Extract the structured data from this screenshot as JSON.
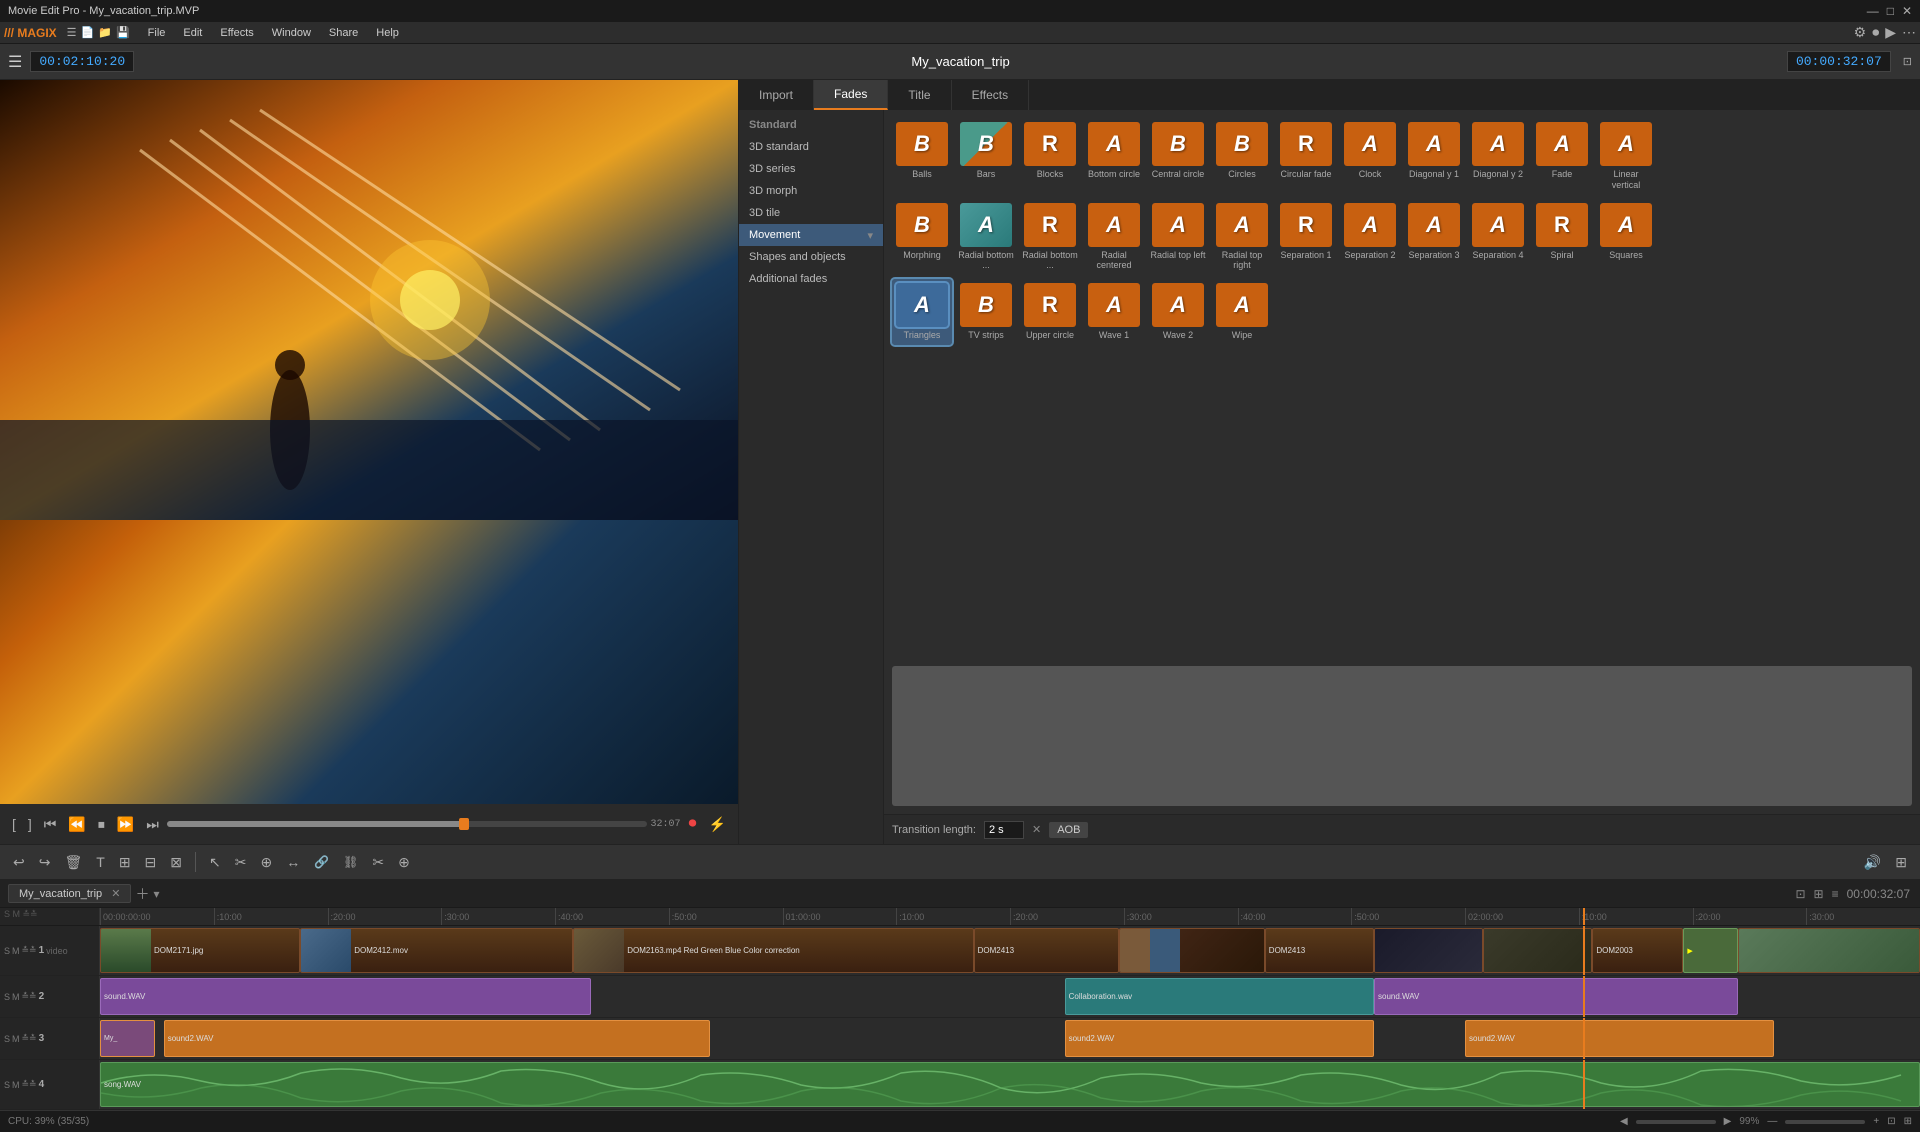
{
  "titlebar": {
    "title": "Movie Edit Pro - My_vacation_trip.MVP",
    "minimize": "—",
    "maximize": "□",
    "close": "✕"
  },
  "menubar": {
    "logo": "/// MAGIX",
    "items": [
      "File",
      "Edit",
      "Effects",
      "Window",
      "Share",
      "Help"
    ]
  },
  "transport": {
    "timecode_left": "00:02:10:20",
    "project_name": "My_vacation_trip",
    "timecode_right": "00:00:32:07"
  },
  "panel_tabs": [
    "Import",
    "Fades",
    "Title",
    "Effects"
  ],
  "active_panel_tab": "Fades",
  "categories": {
    "standard_label": "Standard",
    "items": [
      {
        "id": "3d_standard",
        "label": "3D standard"
      },
      {
        "id": "3d_series",
        "label": "3D series"
      },
      {
        "id": "3d_morph",
        "label": "3D morph"
      },
      {
        "id": "3d_tile",
        "label": "3D tile"
      },
      {
        "id": "movement",
        "label": "Movement",
        "active": true
      },
      {
        "id": "shapes_objects",
        "label": "Shapes and objects"
      },
      {
        "id": "additional_fades",
        "label": "Additional fades"
      }
    ]
  },
  "effects": [
    {
      "id": "balls",
      "label": "Balls",
      "letter": "B",
      "type": "orange"
    },
    {
      "id": "bars",
      "label": "Bars",
      "letter": "B",
      "type": "orange-teal"
    },
    {
      "id": "blocks",
      "label": "Blocks",
      "letter": "R",
      "type": "orange-r"
    },
    {
      "id": "bottom_circle",
      "label": "Bottom circle",
      "letter": "A",
      "type": "orange-a"
    },
    {
      "id": "central_circle",
      "label": "Central circle",
      "letter": "B",
      "type": "orange-b"
    },
    {
      "id": "circles",
      "label": "Circles",
      "letter": "B",
      "type": "orange-b2"
    },
    {
      "id": "circular_fade",
      "label": "Circular fade",
      "letter": "R",
      "type": "orange-r2"
    },
    {
      "id": "clock",
      "label": "Clock",
      "letter": "A",
      "type": "orange-a2"
    },
    {
      "id": "diagonal_y1",
      "label": "Diagonal y 1",
      "letter": "A",
      "type": "orange-diag1"
    },
    {
      "id": "diagonal_y2",
      "label": "Diagonal y 2",
      "letter": "A",
      "type": "orange-diag2"
    },
    {
      "id": "fade",
      "label": "Fade",
      "letter": "A",
      "type": "orange-fade"
    },
    {
      "id": "linear_vertical",
      "label": "Linear vertical",
      "letter": "A",
      "type": "orange-lv"
    },
    {
      "id": "morphing",
      "label": "Morphing",
      "letter": "B",
      "type": "orange-morph"
    },
    {
      "id": "radial_bottom_left",
      "label": "Radial bottom ...",
      "letter": "A",
      "type": "teal-a"
    },
    {
      "id": "radial_bottom_right",
      "label": "Radial bottom ...",
      "letter": "R",
      "type": "orange-rbr"
    },
    {
      "id": "radial_centered",
      "label": "Radial centered",
      "letter": "A",
      "type": "orange-rc"
    },
    {
      "id": "radial_top_left",
      "label": "Radial top left",
      "letter": "A",
      "type": "orange-rtl"
    },
    {
      "id": "radial_top_right",
      "label": "Radial top right",
      "letter": "A",
      "type": "orange-rtr"
    },
    {
      "id": "separation1",
      "label": "Separation 1",
      "letter": "R",
      "type": "orange-s1"
    },
    {
      "id": "separation2",
      "label": "Separation 2",
      "letter": "A",
      "type": "orange-s2"
    },
    {
      "id": "separation3",
      "label": "Separation 3",
      "letter": "A",
      "type": "orange-s3"
    },
    {
      "id": "separation4",
      "label": "Separation 4",
      "letter": "A",
      "type": "orange-s4"
    },
    {
      "id": "spiral",
      "label": "Spiral",
      "letter": "R",
      "type": "orange-spiral"
    },
    {
      "id": "squares",
      "label": "Squares",
      "letter": "A",
      "type": "orange-sq"
    },
    {
      "id": "triangles",
      "label": "Triangles",
      "letter": "A",
      "type": "selected",
      "selected": true
    },
    {
      "id": "tv_strips",
      "label": "TV strips",
      "letter": "B",
      "type": "orange-tv"
    },
    {
      "id": "upper_circle",
      "label": "Upper circle",
      "letter": "R",
      "type": "orange-uc"
    },
    {
      "id": "wave1",
      "label": "Wave 1",
      "letter": "A",
      "type": "orange-w1"
    },
    {
      "id": "wave2",
      "label": "Wave 2",
      "letter": "A",
      "type": "orange-w2"
    },
    {
      "id": "wipe",
      "label": "Wipe",
      "letter": "A",
      "type": "orange-wipe"
    }
  ],
  "transition_length": {
    "label": "Transition length:",
    "value": "2 s",
    "button": "AOB"
  },
  "timeline": {
    "tab_name": "My_vacation_trip",
    "total_time": "00:00:32:07",
    "playhead_time": "00:02:10:20",
    "ruler_marks": [
      "00:00:00:00",
      "00:00:10:00",
      "00:00:20:00",
      "00:00:30:00",
      "00:00:40:00",
      "00:00:50:00",
      "00:01:00:00",
      "00:01:10:00",
      "00:01:20:00",
      "00:01:30:00",
      "00:01:40:00",
      "00:01:50:00",
      "00:02:00:00",
      "00:02:10:00",
      "00:02:20:00",
      "00:02:30:00"
    ],
    "tracks": [
      {
        "id": 1,
        "type": "video",
        "num": "1",
        "label": "video"
      },
      {
        "id": 2,
        "type": "audio",
        "num": "2"
      },
      {
        "id": 3,
        "type": "audio",
        "num": "3"
      },
      {
        "id": 4,
        "type": "audio",
        "num": "4"
      }
    ],
    "clips_track1": [
      {
        "id": "c1",
        "label": "DOM2171.jpg",
        "left": "0%",
        "width": "12%"
      },
      {
        "id": "c2",
        "label": "DOM2412.mov",
        "left": "12%",
        "width": "14%"
      },
      {
        "id": "c3",
        "label": "DOM2163.mp4 Red Green Blue Color correction",
        "left": "26%",
        "width": "22%"
      },
      {
        "id": "c4",
        "label": "DOM2413.mp4",
        "left": "48%",
        "width": "10%"
      },
      {
        "id": "c5",
        "label": "",
        "left": "58%",
        "width": "9%"
      },
      {
        "id": "c6",
        "label": "DOM2413.mp4",
        "left": "67%",
        "width": "8%"
      },
      {
        "id": "c7",
        "label": "",
        "left": "75%",
        "width": "8%"
      },
      {
        "id": "c8",
        "label": "DOM2003.jpg",
        "left": "83%",
        "width": "7%"
      },
      {
        "id": "c9",
        "label": "",
        "left": "90%",
        "width": "5%"
      },
      {
        "id": "c10",
        "label": "DOM2003.jpg",
        "left": "89.5%",
        "width": "5.5%"
      },
      {
        "id": "c11",
        "label": "",
        "left": "95%",
        "width": "5%"
      }
    ],
    "clips_track2": [
      {
        "id": "a1",
        "label": "sound.WAV",
        "left": "0%",
        "width": "27%",
        "color": "purple"
      },
      {
        "id": "a2",
        "label": "Collaboration.wav",
        "left": "53%",
        "width": "17%",
        "color": "teal"
      },
      {
        "id": "a3",
        "label": "sound.WAV",
        "left": "70%",
        "width": "20%",
        "color": "purple"
      }
    ],
    "clips_track3": [
      {
        "id": "b0",
        "label": "My_",
        "left": "0%",
        "width": "4%",
        "color": "orange-small"
      },
      {
        "id": "b1",
        "label": "sound2.WAV",
        "left": "4%",
        "width": "30%",
        "color": "orange"
      },
      {
        "id": "b2",
        "label": "sound2.WAV",
        "left": "53%",
        "width": "17%",
        "color": "orange"
      },
      {
        "id": "b3",
        "label": "sound2.WAV",
        "left": "75%",
        "width": "17%",
        "color": "orange"
      }
    ],
    "clips_track4": [
      {
        "id": "s1",
        "label": "song.WAV",
        "left": "0%",
        "width": "100%",
        "color": "green"
      }
    ]
  },
  "statusbar": {
    "cpu": "CPU: 39% (35/35)",
    "zoom": "99%"
  },
  "toolbar_tools": [
    "↩",
    "↪",
    "🗑",
    "T",
    "⊞",
    "⊟",
    "⊠",
    "|",
    "↖",
    "✂",
    "⊕",
    "↔",
    "⊗",
    "⊘",
    "✂",
    "⊕"
  ]
}
